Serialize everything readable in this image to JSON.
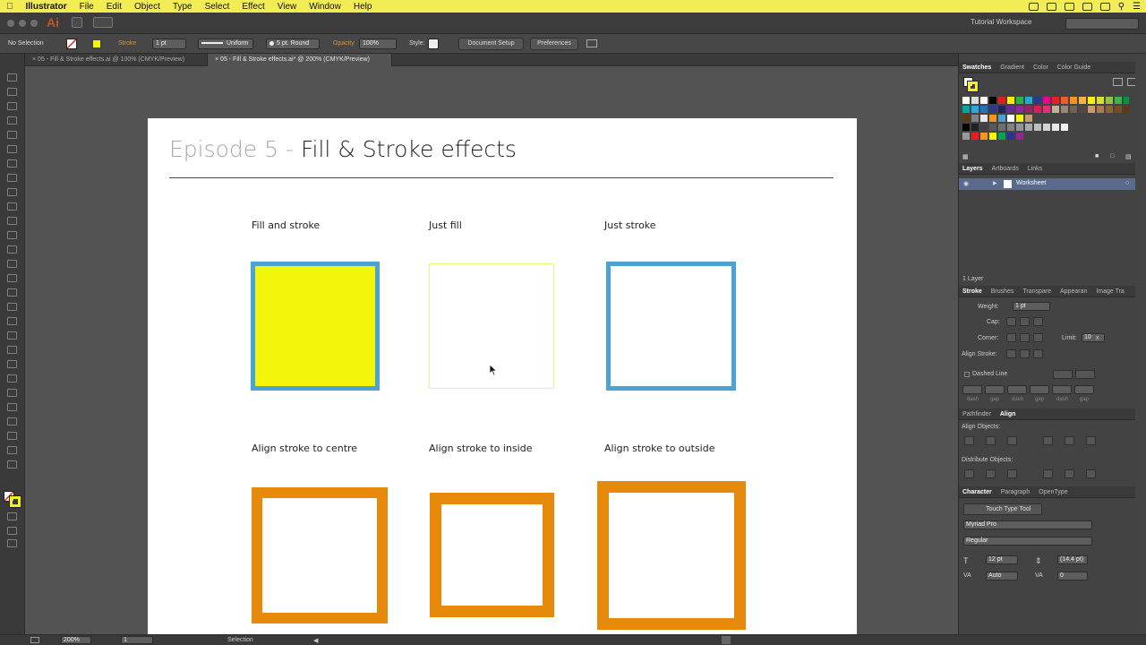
{
  "menubar": {
    "apple_icon": "apple-icon",
    "items": [
      "Illustrator",
      "File",
      "Edit",
      "Object",
      "Type",
      "Select",
      "Effect",
      "View",
      "Window",
      "Help"
    ]
  },
  "appbar": {
    "app_badge": "Ai",
    "workspace": "Tutorial Workspace"
  },
  "control": {
    "selection_status": "No Selection",
    "stroke_label": "Stroke",
    "stroke_weight": "1 pt",
    "profile": "Uniform",
    "brush": "5 pt. Round",
    "opacity_label": "Opacity",
    "opacity_value": "100%",
    "style_label": "Style:",
    "document_setup": "Document Setup",
    "preferences": "Preferences"
  },
  "tabs": [
    {
      "label": "05 - Fill & Stroke effects.ai @ 100% (CMYK/Preview)"
    },
    {
      "label": "05 - Fill & Stroke effects.ai* @ 200% (CMYK/Preview)"
    }
  ],
  "artboard": {
    "title_prefix": "Episode 5 - ",
    "title_main": "Fill & Stroke effects",
    "captions": [
      "Fill and stroke",
      "Just fill",
      "Just stroke",
      "Align stroke to centre",
      "Align stroke to inside",
      "Align stroke to outside"
    ]
  },
  "colors": {
    "fill_yellow": "#f3f50b",
    "stroke_blue": "#4aa3d3",
    "orange": "#e7890b",
    "just_fill_stroke": "#f2f27a"
  },
  "panels": {
    "swatch_tabs": [
      "Swatches",
      "Gradient",
      "Color",
      "Color Guide"
    ],
    "layers_tabs": [
      "Layers",
      "Artboards",
      "Links"
    ],
    "layer_name": "Worksheet",
    "layer_count": "1 Layer",
    "stroke_tabs": [
      "Stroke",
      "Brushes",
      "Transpare",
      "Appearan",
      "Image Tra"
    ],
    "weight_label": "Weight:",
    "weight_value": "1 pt",
    "cap_label": "Cap:",
    "corner_label": "Corner:",
    "limit_label": "Limit:",
    "limit_value": "10",
    "limit_unit": "x",
    "align_stroke_label": "Align Stroke:",
    "dashed_line": "Dashed Line",
    "dash_labels": [
      "dash",
      "gap",
      "dash",
      "gap",
      "dash",
      "gap"
    ],
    "align_tabs": [
      "Pathfinder",
      "Align"
    ],
    "align_objects": "Align Objects:",
    "distribute_objects": "Distribute Objects:",
    "char_tabs": [
      "Character",
      "Paragraph",
      "OpenType"
    ],
    "touch_type": "Touch Type Tool",
    "font_family": "Myriad Pro",
    "font_style": "Regular",
    "font_size": "12 pt",
    "leading": "(14.4 pt)",
    "kerning": "Auto",
    "tracking": "0"
  },
  "status": {
    "zoom": "200%",
    "page": "1",
    "tool": "Selection"
  }
}
